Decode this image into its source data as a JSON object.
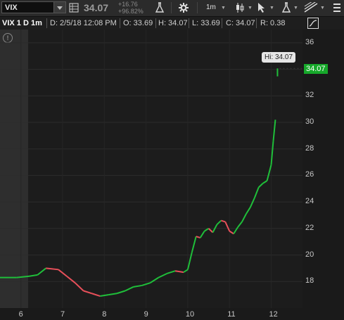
{
  "toolbar": {
    "symbol": "VIX",
    "last": "34.07",
    "change_net": "+16.76",
    "change_pct": "+96.82%",
    "timeframe": "1m"
  },
  "infobar": {
    "symbol_agg": "VIX 1 D 1m",
    "date": "D: 2/5/18 12:08 PM",
    "open": "O: 33.69",
    "high": "H: 34.07",
    "low": "L: 33.69",
    "close": "C: 34.07",
    "range": "R: 0.38"
  },
  "chart": {
    "current_price_label": "34.07",
    "high_bubble": "Hi: 34.07",
    "up_color": "#1fbf3a",
    "down_color": "#e8505a",
    "premarket_color": "#2e2e2e",
    "alert_glyph": "!"
  },
  "chart_data": {
    "type": "line",
    "ylim": [
      16,
      37
    ],
    "yticks": [
      "36",
      "34",
      "32",
      "30",
      "28",
      "26",
      "24",
      "22",
      "20",
      "18"
    ],
    "xticks": [
      "6",
      "7",
      "8",
      "9",
      "10",
      "11",
      "12"
    ],
    "x_range": [
      5.5,
      12.75
    ],
    "series": [
      {
        "x": [
          5.5,
          5.9,
          6.2,
          6.4,
          6.6,
          6.9,
          7.1,
          7.3,
          7.5,
          7.7,
          7.9,
          8.1,
          8.3,
          8.5,
          8.7,
          8.9,
          9.1,
          9.3,
          9.5,
          9.7,
          9.9,
          10.0,
          10.1,
          10.2,
          10.3,
          10.4,
          10.5,
          10.6,
          10.7,
          10.8,
          10.9,
          11.0,
          11.1,
          11.2,
          11.3,
          11.4,
          11.5,
          11.6,
          11.7,
          11.8,
          11.9,
          12.0,
          12.05,
          12.1
        ],
        "y": [
          18.3,
          18.3,
          18.4,
          18.5,
          19.0,
          18.9,
          18.4,
          17.9,
          17.3,
          17.1,
          16.9,
          17.0,
          17.1,
          17.3,
          17.6,
          17.7,
          17.9,
          18.3,
          18.6,
          18.8,
          18.7,
          18.9,
          20.2,
          21.4,
          21.3,
          21.8,
          22.0,
          21.7,
          22.3,
          22.6,
          22.5,
          21.8,
          21.6,
          22.1,
          22.5,
          23.1,
          23.6,
          24.3,
          25.1,
          25.4,
          25.6,
          26.8,
          28.6,
          30.2
        ]
      }
    ],
    "last_point": {
      "x": 12.1,
      "y": 34.07
    },
    "high": 34.07
  }
}
